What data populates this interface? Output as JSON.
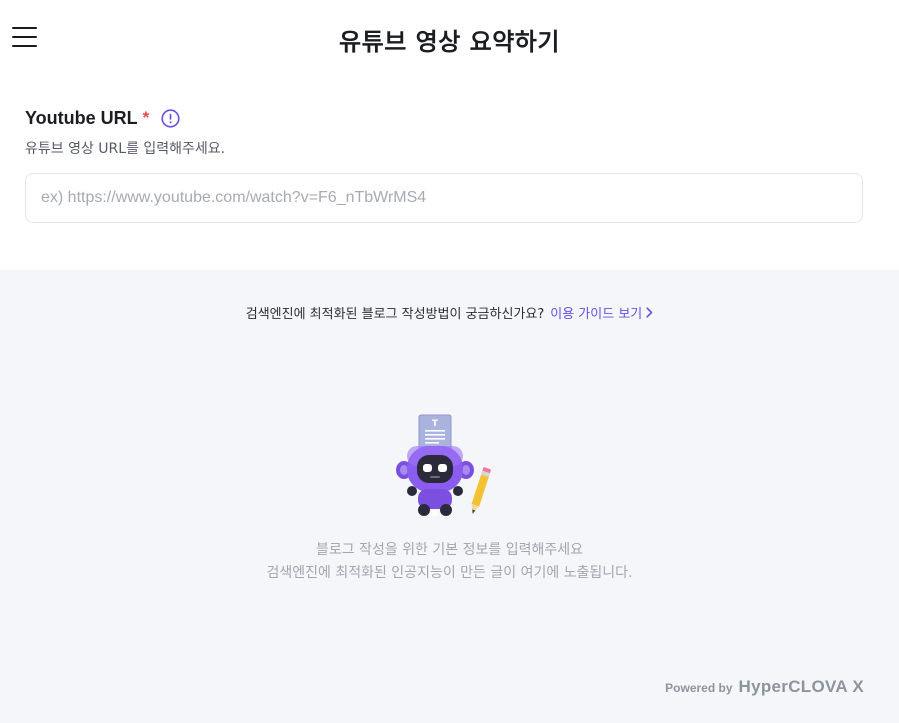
{
  "header": {
    "title": "유튜브 영상 요약하기",
    "menu_icon": "hamburger-menu-icon"
  },
  "form": {
    "label": "Youtube URL",
    "required_mark": "*",
    "info_icon": "info-circle-icon",
    "helper": "유튜브 영상 URL를 입력해주세요.",
    "url_placeholder": "ex) https://www.youtube.com/watch?v=F6_nTbWrMS4",
    "url_value": ""
  },
  "guide": {
    "question": "검색엔진에 최적화된 블로그 작성방법이 궁금하신가요?",
    "link": "이용 가이드 보기",
    "chevron_icon": "chevron-right-icon"
  },
  "empty_state": {
    "illustration": "robot-writer-illustration",
    "line1": "블로그 작성을 위한 기본 정보를 입력해주세요",
    "line2": "검색엔진에 최적화된 인공지능이 만든 글이 여기에 노출됩니다."
  },
  "footer": {
    "powered_by": "Powered by",
    "brand": "HyperCLOVA X"
  },
  "colors": {
    "accent": "#6a4de8",
    "required": "#e5484d",
    "panel_bg": "#f4f6f9"
  }
}
